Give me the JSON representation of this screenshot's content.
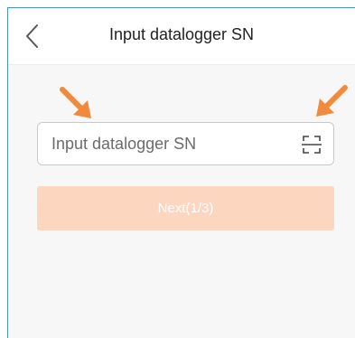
{
  "header": {
    "title": "Input datalogger SN",
    "back_icon": "chevron-left-icon"
  },
  "form": {
    "sn_input": {
      "value": "",
      "placeholder": "Input datalogger SN"
    },
    "scan_icon": "scan-frame-icon",
    "next_button_label": "Next(1/3)"
  },
  "annotations": {
    "arrow_icon": "arrow-down-right-icon",
    "arrow_color": "#f08a3c"
  },
  "colors": {
    "border_accent": "#4a90c8",
    "next_button_bg": "#fcd6bf",
    "background": "#f7f7f7"
  }
}
